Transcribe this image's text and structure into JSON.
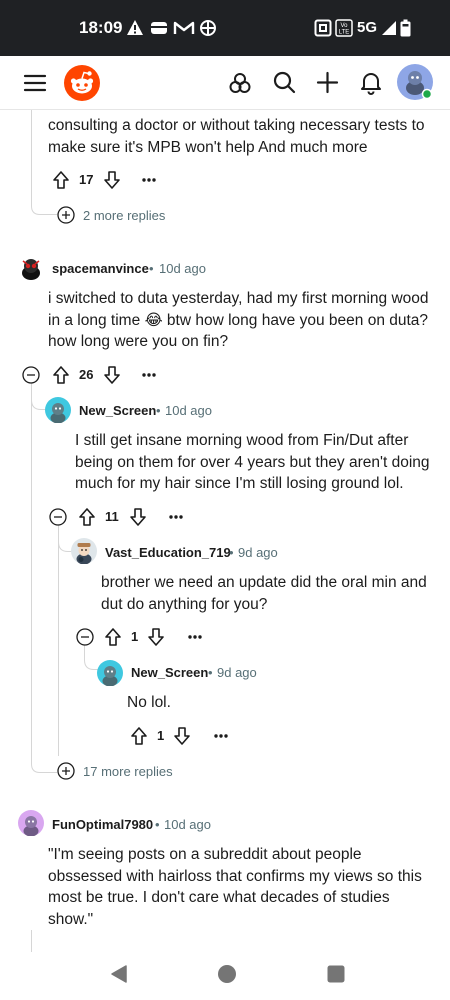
{
  "status_bar": {
    "time": "18:09",
    "network": "5G",
    "volte_label": "Vo\nLTE"
  },
  "app_bar": {
    "menu_icon": "hamburger-menu-icon",
    "logo_icon": "reddit-logo-icon",
    "actions": [
      "communities-icon",
      "search-icon",
      "create-post-icon",
      "notifications-icon",
      "user-avatar"
    ],
    "accent_color": "#ff4500"
  },
  "thread": {
    "c0": {
      "text_lines": [
        "consulting a doctor or without taking necessary tests to",
        "make sure it's MPB won't help  And much more"
      ],
      "votes": "17",
      "more_replies": "2 more replies"
    },
    "c1": {
      "username": "spacemanvince",
      "sep": "•",
      "age": "10d ago",
      "text_lines": [
        "i switched to duta yesterday, had my first morning wood",
        "in a long time 😂 btw how long have you been on duta?",
        "how long were you on fin?"
      ],
      "votes": "26",
      "more_replies": "17 more replies"
    },
    "c2": {
      "username": "New_Screen",
      "sep": "•",
      "age": "10d ago",
      "text_lines": [
        "I still get insane morning wood from Fin/Dut after",
        "being on them for over 4 years but they aren't doing",
        "much for my hair since I'm still losing ground lol."
      ],
      "votes": "11"
    },
    "c3": {
      "username": "Vast_Education_719",
      "sep": "•",
      "age": "9d ago",
      "text_lines": [
        "brother we need an update did the oral min and",
        "dut do anything for you?"
      ],
      "votes": "1"
    },
    "c4": {
      "username": "New_Screen",
      "sep": "•",
      "age": "9d ago",
      "text_lines": [
        "No lol."
      ],
      "votes": "1"
    },
    "c5": {
      "username": "FunOptimal7980",
      "sep": "•",
      "age": "10d ago",
      "text_lines": [
        "\"I'm seeing posts on a subreddit about people",
        "obssessed with hairloss that confirms my views so this",
        "most be true. I don't care what decades of studies",
        "show.\""
      ]
    }
  },
  "nav_bar": {
    "buttons": [
      "back-icon",
      "home-icon",
      "recents-icon"
    ]
  }
}
